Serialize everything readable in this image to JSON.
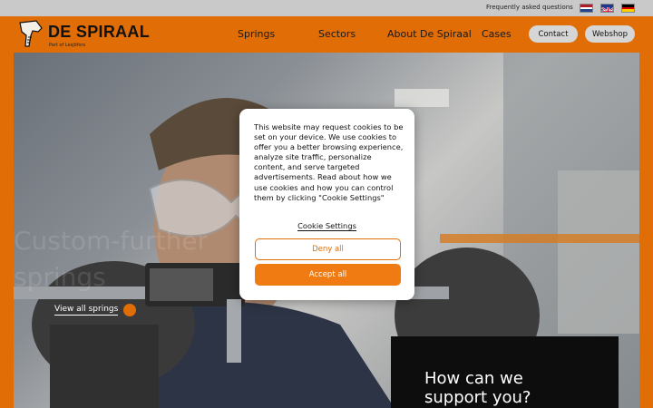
{
  "topbar": {
    "faq_label": "Frequently asked questions",
    "languages": [
      {
        "name": "Dutch",
        "icon": "flag-nl-icon"
      },
      {
        "name": "English",
        "icon": "flag-uk-icon"
      },
      {
        "name": "German",
        "icon": "flag-de-icon"
      }
    ]
  },
  "header": {
    "logo_text": "DE SPIRAAL",
    "logo_sub": "Part of Lesjöfors",
    "nav": [
      "Springs",
      "Sectors",
      "About De Spiraal",
      "Cases"
    ],
    "contact_label": "Contact",
    "webshop_label": "Webshop"
  },
  "hero": {
    "ghost_line1": "Custom-further",
    "ghost_line2": "springs",
    "view_all_label": "View all springs",
    "support_title": "How can we support you?"
  },
  "cookie": {
    "body": "This website may request cookies to be set on your device. We use cookies to offer you a better browsing experience, analyze site traffic, personalize content, and serve targeted advertisements. Read about how we use cookies and how you can control them by clicking \"Cookie Settings\"",
    "settings_label": "Cookie Settings",
    "deny_label": "Deny all",
    "accept_label": "Accept all"
  },
  "colors": {
    "brand_orange": "#e06d06",
    "accept_orange": "#ef7b12",
    "topbar_gray": "#c9c9c9",
    "pill_gray": "#d6d6d6"
  }
}
